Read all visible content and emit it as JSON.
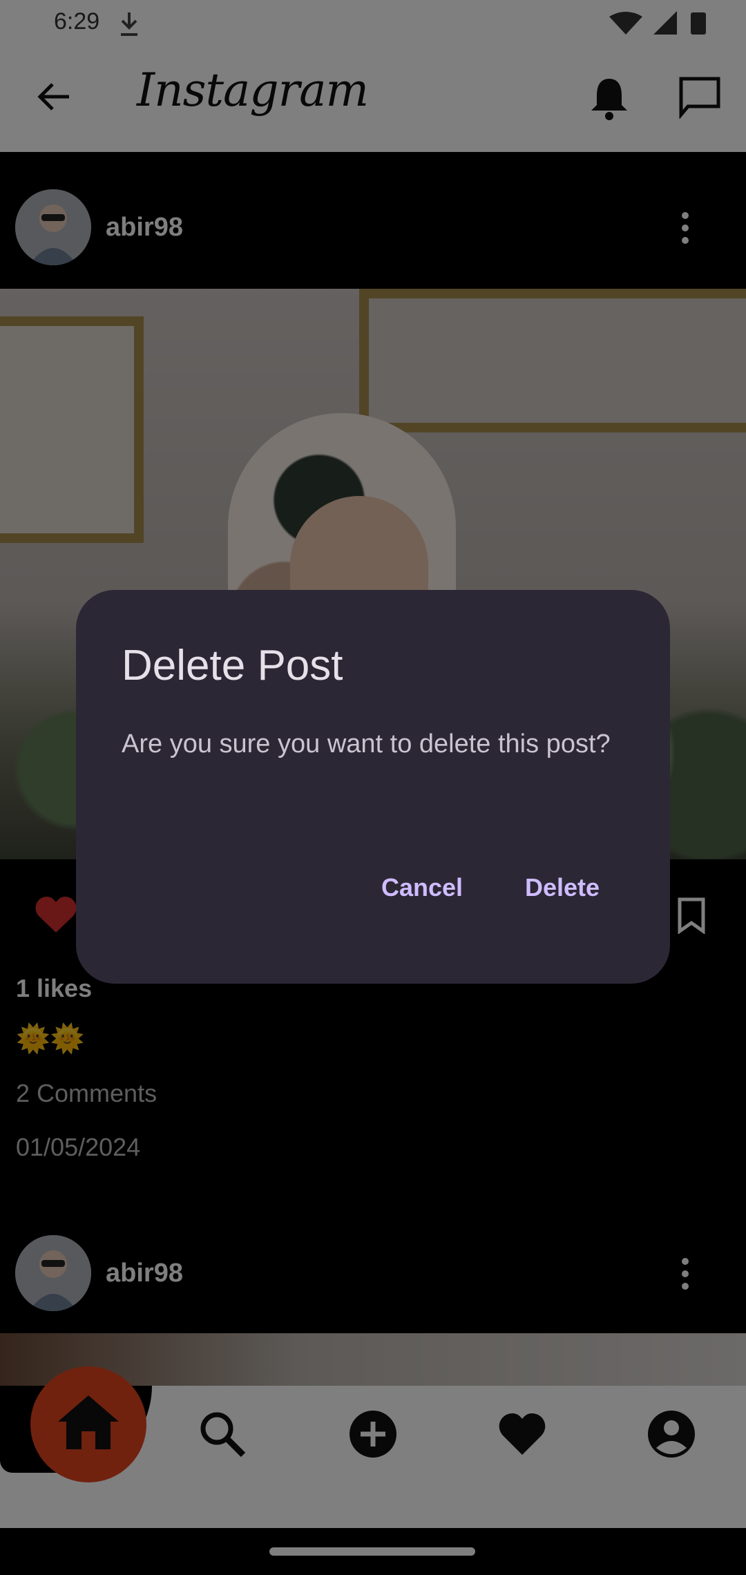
{
  "status_bar": {
    "time": "6:29",
    "icons": [
      "download-icon",
      "wifi-icon",
      "signal-icon",
      "battery-icon"
    ]
  },
  "app_bar": {
    "logo": "Instagram",
    "icons": [
      "back-arrow-icon",
      "bell-icon",
      "chat-icon"
    ]
  },
  "posts": [
    {
      "username": "abir98",
      "likes": "1 likes",
      "caption": "🌞🌞",
      "comments": "2 Comments",
      "date": "01/05/2024"
    },
    {
      "username": "abir98"
    }
  ],
  "bottom_nav": {
    "items": [
      "home-icon",
      "search-icon",
      "add-icon",
      "heart-icon",
      "profile-icon"
    ],
    "active": "home-icon"
  },
  "dialog": {
    "title": "Delete Post",
    "message": "Are you sure you want to delete this post?",
    "cancel_label": "Cancel",
    "delete_label": "Delete"
  },
  "colors": {
    "accent": "#e1451f",
    "dialog_bg": "#2c2735",
    "dialog_button": "#cfbcff",
    "liked": "#d32f2f"
  }
}
